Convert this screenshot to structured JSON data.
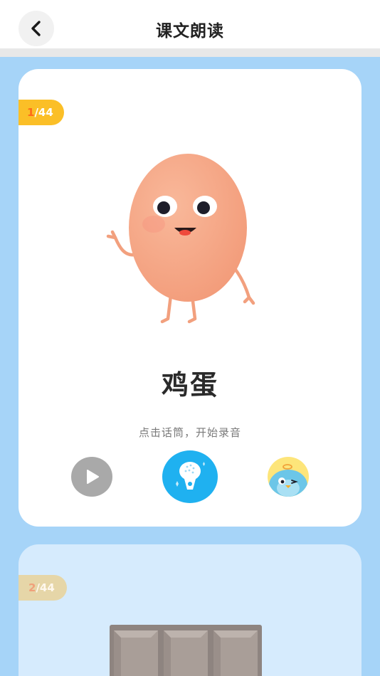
{
  "header": {
    "title": "课文朗读",
    "back_icon": "chevron-left-icon"
  },
  "cards": [
    {
      "progress_current": "1",
      "progress_total": "/44",
      "word": "鸡蛋",
      "hint": "点击话筒，开始录音",
      "illustration": "egg-character",
      "controls": {
        "play_icon": "play-icon",
        "mic_icon": "microphone-icon",
        "avatar_icon": "bird-avatar-icon"
      }
    },
    {
      "progress_current": "2",
      "progress_total": "/44",
      "illustration": "chocolate-bar"
    }
  ],
  "colors": {
    "page_bg": "#a6d4f8",
    "badge_active": "#fbbf27",
    "mic_blue": "#1fb1f0",
    "play_gray": "#a9a9a9"
  }
}
